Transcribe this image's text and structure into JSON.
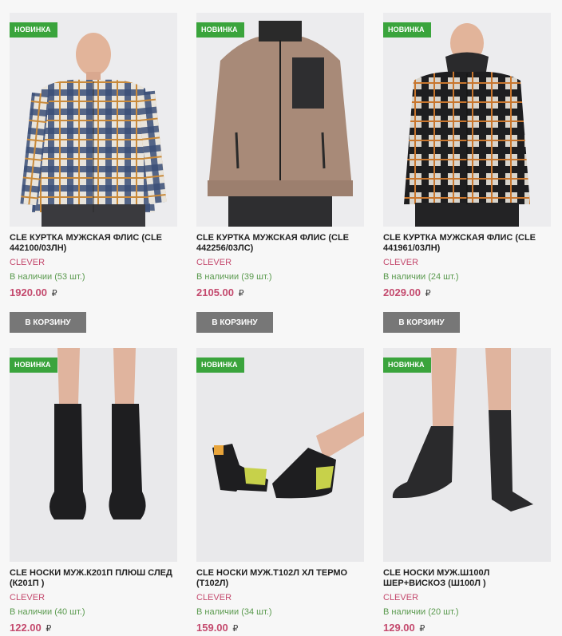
{
  "colors": {
    "badge": "#3aa43c",
    "brand": "#c44a6e",
    "stock": "#5a9a4e",
    "button": "#777777"
  },
  "products": [
    {
      "badge": "НОВИНКА",
      "title": "CLE КУРТКА МУЖСКАЯ ФЛИС (CLE 442100/03ЛН)",
      "brand": "CLEVER",
      "stock": "В наличии (53 шт.)",
      "price": "1920.00",
      "currency": "₽",
      "button": "В КОРЗИНУ",
      "image": "man-plaid-shirt-blue"
    },
    {
      "badge": "НОВИНКА",
      "title": "CLE КУРТКА МУЖСКАЯ ФЛИС (CLE 442256/03ЛС)",
      "brand": "CLEVER",
      "stock": "В наличии (39 шт.)",
      "price": "2105.00",
      "currency": "₽",
      "button": "В КОРЗИНУ",
      "image": "man-fleece-jacket-beige"
    },
    {
      "badge": "НОВИНКА",
      "title": "CLE КУРТКА МУЖСКАЯ ФЛИС (CLE 441961/03ЛН)",
      "brand": "CLEVER",
      "stock": "В наличии (24 шт.)",
      "price": "2029.00",
      "currency": "₽",
      "button": "В КОРЗИНУ",
      "image": "man-plaid-shirt-dark"
    },
    {
      "badge": "НОВИНКА",
      "title": "CLE НОСКИ МУЖ.К201П ПЛЮШ СЛЕД (К201П )",
      "brand": "CLEVER",
      "stock": "В наличии (40 шт.)",
      "price": "122.00",
      "currency": "₽",
      "image": "black-socks"
    },
    {
      "badge": "НОВИНКА",
      "title": "CLE НОСКИ МУЖ.Т102Л ХЛ ТЕРМО (Т102Л)",
      "brand": "CLEVER",
      "stock": "В наличии (34 шт.)",
      "price": "159.00",
      "currency": "₽",
      "image": "thermo-socks"
    },
    {
      "badge": "НОВИНКА",
      "title": "CLE НОСКИ МУЖ.Ш100Л ШЕР+ВИСКОЗ (Ш100Л )",
      "brand": "CLEVER",
      "stock": "В наличии (20 шт.)",
      "price": "129.00",
      "currency": "₽",
      "image": "black-socks-wool"
    }
  ]
}
